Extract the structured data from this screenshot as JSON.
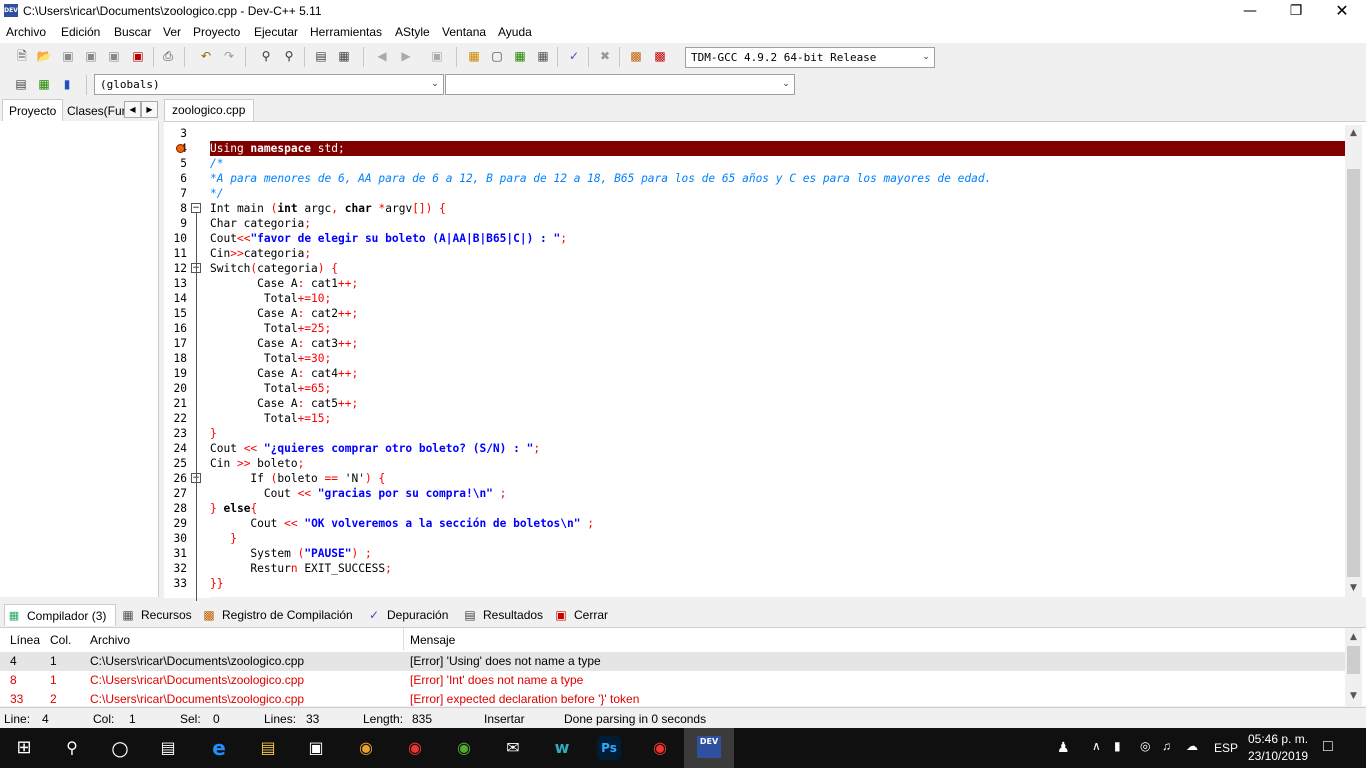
{
  "window": {
    "title": "C:\\Users\\ricar\\Documents\\zoologico.cpp - Dev-C++ 5.11",
    "app_icon_text": "DEV"
  },
  "menu": [
    "Archivo",
    "Edición",
    "Buscar",
    "Ver",
    "Proyecto",
    "Ejecutar",
    "Herramientas",
    "AStyle",
    "Ventana",
    "Ayuda"
  ],
  "toolbar": {
    "compiler": "TDM-GCC 4.9.2 64-bit Release",
    "scope": "(globals)",
    "member": ""
  },
  "left_tabs": [
    "Proyecto",
    "Clases(Fun"
  ],
  "file_tab": "zoologico.cpp",
  "code_lines": [
    {
      "n": "3",
      "html": ""
    },
    {
      "n": "4",
      "html": "<span class=\"errline\">Using <b>namespace</b> std;</span>",
      "err": true
    },
    {
      "n": "5",
      "html": "<span class=\"cm\">/*</span>"
    },
    {
      "n": "6",
      "html": "<span class=\"cm\">*A para menores de 6, AA para de 6 a 12, B para de 12 a 18, B65 para los de 65 años y C es para los mayores de edad.</span>"
    },
    {
      "n": "7",
      "html": "<span class=\"cm\">*/</span>"
    },
    {
      "n": "8",
      "html": "Int main <span class=\"sym\">(</span><span class=\"kw\">int</span> argc<span class=\"sym\">,</span> <span class=\"kw\">char</span> <span class=\"sym\">*</span>argv<span class=\"sym\">[])</span> <span class=\"sym\">{</span>",
      "fold": true
    },
    {
      "n": "9",
      "html": "Char categoria<span class=\"sym\">;</span>"
    },
    {
      "n": "10",
      "html": "Cout<span class=\"sym\">&lt;&lt;</span><span class=\"str\">\"favor de elegir su boleto (A|AA|B|B65|C|) : \"</span><span class=\"sym\">;</span>"
    },
    {
      "n": "11",
      "html": "Cin<span class=\"sym\">&gt;&gt;</span>categoria<span class=\"sym\">;</span>"
    },
    {
      "n": "12",
      "html": "Switch<span class=\"sym\">(</span>categoria<span class=\"sym\">)</span> <span class=\"sym\">{</span>",
      "fold": true
    },
    {
      "n": "13",
      "html": "       Case A<span class=\"sym\">:</span> cat1<span class=\"sym\">++;</span>"
    },
    {
      "n": "14",
      "html": "        Total<span class=\"sym\">+=</span><span class=\"sym\">10;</span>"
    },
    {
      "n": "15",
      "html": "       Case A<span class=\"sym\">:</span> cat2<span class=\"sym\">++;</span>"
    },
    {
      "n": "16",
      "html": "        Total<span class=\"sym\">+=</span><span class=\"sym\">25;</span>"
    },
    {
      "n": "17",
      "html": "       Case A<span class=\"sym\">:</span> cat3<span class=\"sym\">++;</span>"
    },
    {
      "n": "18",
      "html": "        Total<span class=\"sym\">+=</span><span class=\"sym\">30;</span>"
    },
    {
      "n": "19",
      "html": "       Case A<span class=\"sym\">:</span> cat4<span class=\"sym\">++;</span>"
    },
    {
      "n": "20",
      "html": "        Total<span class=\"sym\">+=</span><span class=\"sym\">65;</span>"
    },
    {
      "n": "21",
      "html": "       Case A<span class=\"sym\">:</span> cat5<span class=\"sym\">++;</span>"
    },
    {
      "n": "22",
      "html": "        Total<span class=\"sym\">+=</span><span class=\"sym\">15;</span>"
    },
    {
      "n": "23",
      "html": "<span class=\"sym\">}</span>"
    },
    {
      "n": "24",
      "html": "Cout <span class=\"sym\">&lt;&lt;</span> <span class=\"str\">\"¿quieres comprar otro boleto? (S/N) : \"</span><span class=\"sym\">;</span>"
    },
    {
      "n": "25",
      "html": "Cin <span class=\"sym\">&gt;&gt;</span> boleto<span class=\"sym\">;</span>"
    },
    {
      "n": "26",
      "html": "      If <span class=\"sym\">(</span>boleto <span class=\"sym\">==</span> 'N'<span class=\"sym\">)</span> <span class=\"sym\">{</span>",
      "fold": true
    },
    {
      "n": "27",
      "html": "        Cout <span class=\"sym\">&lt;&lt;</span> <span class=\"str\">\"gracias por su compra!\\n\"</span> <span class=\"sym\">;</span>"
    },
    {
      "n": "28",
      "html": "<span class=\"sym\">}</span> <span class=\"kw\">else</span><span class=\"sym\">{</span>"
    },
    {
      "n": "29",
      "html": "      Cout <span class=\"sym\">&lt;&lt;</span> <span class=\"str\">\"OK volveremos a la sección de boletos\\n\"</span> <span class=\"sym\">;</span>"
    },
    {
      "n": "30",
      "html": "   <span class=\"sym\">}</span>"
    },
    {
      "n": "31",
      "html": "      System <span class=\"sym\">(</span><span class=\"str\">\"PAUSE\"</span><span class=\"sym\">)</span> <span class=\"sym\">;</span>"
    },
    {
      "n": "32",
      "html": "      Restur<span class=\"sym\">n</span> EXIT_SUCCESS<span class=\"sym\">;</span>"
    },
    {
      "n": "33",
      "html": "<span class=\"sym\">}}</span>"
    }
  ],
  "bottom_tabs": [
    "Compilador (3)",
    "Recursos",
    "Registro de Compilación",
    "Depuración",
    "Resultados",
    "Cerrar"
  ],
  "messages": {
    "headers": [
      "Línea",
      "Col.",
      "Archivo",
      "Mensaje"
    ],
    "rows": [
      {
        "line": "4",
        "col": "1",
        "file": "C:\\Users\\ricar\\Documents\\zoologico.cpp",
        "msg": "[Error] 'Using' does not name a type",
        "selected": true
      },
      {
        "line": "8",
        "col": "1",
        "file": "C:\\Users\\ricar\\Documents\\zoologico.cpp",
        "msg": "[Error] 'Int' does not name a type",
        "selected": false
      },
      {
        "line": "33",
        "col": "2",
        "file": "C:\\Users\\ricar\\Documents\\zoologico.cpp",
        "msg": "[Error] expected declaration before '}' token",
        "selected": false
      }
    ]
  },
  "status": {
    "line_label": "Line:",
    "line": "4",
    "col_label": "Col:",
    "col": "1",
    "sel_label": "Sel:",
    "sel": "0",
    "lines_label": "Lines:",
    "lines": "33",
    "length_label": "Length:",
    "length": "835",
    "mode": "Insertar",
    "message": "Done parsing in 0 seconds"
  },
  "taskbar": {
    "lang": "ESP",
    "time": "05:46 p. m.",
    "date": "23/10/2019"
  },
  "colors": {
    "error_line": "#800000",
    "string": "#0000ff",
    "symbol": "#ff0000",
    "comment": "#0080ff"
  }
}
